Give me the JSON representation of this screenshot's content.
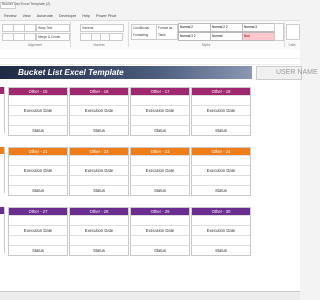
{
  "window": {
    "title": "Bucket List Excel Template (2)"
  },
  "menu_tabs": [
    "Review",
    "View",
    "Automate",
    "Developer",
    "Help",
    "Power Pivot"
  ],
  "ribbon": {
    "wrap_text": "Wrap Text",
    "merge_center": "Merge & Center",
    "number_format": "General",
    "conditional_formatting": "Conditional Formatting",
    "format_as_table": "Format as Table",
    "alignment_label": "Alignment",
    "number_label": "Number",
    "styles_label": "Styles",
    "cells_label": "Cells",
    "styles": [
      "Normal 2",
      "Normal 2 2",
      "Normal 3",
      "Normal 3 2",
      "Normal",
      "Bad"
    ]
  },
  "banner": {
    "title": "Bucket List Excel Template"
  },
  "user": {
    "label": "USER NAME"
  },
  "colors": {
    "purple": "#a02870",
    "orange": "#ef7d1a",
    "violet": "#6b2d8f",
    "banner_dark": "#1e2a44"
  },
  "rows": [
    {
      "color": "#a02870",
      "cards": [
        {
          "title": "Other - 15",
          "fields": [
            "Execution Date",
            "Status"
          ]
        },
        {
          "title": "Other - 16",
          "fields": [
            "Execution Date",
            "Status"
          ]
        },
        {
          "title": "Other - 17",
          "fields": [
            "Execution Date",
            "Status"
          ]
        },
        {
          "title": "Other - 18",
          "fields": [
            "Execution Date",
            "Status"
          ]
        }
      ]
    },
    {
      "color": "#ef7d1a",
      "cards": [
        {
          "title": "Other - 21",
          "fields": [
            "Execution Date",
            "Status"
          ]
        },
        {
          "title": "Other - 22",
          "fields": [
            "Execution Date",
            "Status"
          ]
        },
        {
          "title": "Other - 23",
          "fields": [
            "Execution Date",
            "Status"
          ]
        },
        {
          "title": "Other - 24",
          "fields": [
            "Execution Date",
            "Status"
          ]
        }
      ]
    },
    {
      "color": "#6b2d8f",
      "cards": [
        {
          "title": "Other - 27",
          "fields": [
            "Execution Date",
            "Status"
          ]
        },
        {
          "title": "Other - 28",
          "fields": [
            "Execution Date",
            "Status"
          ]
        },
        {
          "title": "Other - 29",
          "fields": [
            "Execution Date",
            "Status"
          ]
        },
        {
          "title": "Other - 30",
          "fields": [
            "Execution Date",
            "Status"
          ]
        }
      ]
    }
  ]
}
